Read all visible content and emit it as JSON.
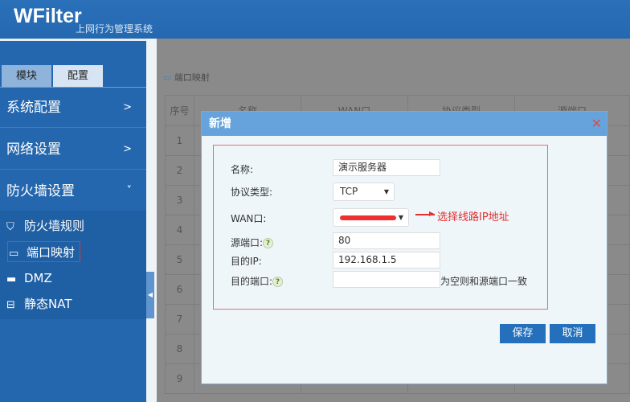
{
  "header": {
    "logo": "WFilter",
    "subtitle": "上网行为管理系统"
  },
  "sidebar": {
    "tabs": [
      "模块",
      "配置"
    ],
    "menus": [
      {
        "label": "系统配置",
        "chevron": ">"
      },
      {
        "label": "网络设置",
        "chevron": ">"
      },
      {
        "label": "防火墙设置",
        "chevron": "˅"
      }
    ],
    "submenu": [
      {
        "label": "防火墙规则",
        "icon": "shield-icon"
      },
      {
        "label": "端口映射",
        "icon": "monitor-icon",
        "selected": true
      },
      {
        "label": "DMZ",
        "icon": "device-icon"
      },
      {
        "label": "静态NAT",
        "icon": "router-icon"
      }
    ]
  },
  "main": {
    "title": "端口映射",
    "columns": [
      "序号",
      "名称",
      "WAN口",
      "协议类型",
      "源端口"
    ],
    "rows": [
      "1",
      "2",
      "3",
      "4",
      "5",
      "6",
      "7",
      "8",
      "9"
    ]
  },
  "modal": {
    "title": "新增",
    "close": "✕",
    "fields": {
      "name_label": "名称:",
      "name_value": "演示服务器",
      "protocol_label": "协议类型:",
      "protocol_value": "TCP",
      "wan_label": "WAN口:",
      "wan_value": "",
      "src_port_label": "源端口:",
      "src_port_value": "80",
      "dest_ip_label": "目的IP:",
      "dest_ip_value": "192.168.1.5",
      "dest_port_label": "目的端口:",
      "dest_port_value": "",
      "dest_port_hint": "为空则和源端口一致",
      "help": "?"
    },
    "annotation": "选择线路IP地址",
    "save": "保存",
    "cancel": "取消"
  },
  "colors": {
    "header": "#2468b0",
    "sidebar": "#2467ae",
    "modal_header": "#66a3dc",
    "button": "#2570bc",
    "annotation": "#e03030"
  }
}
